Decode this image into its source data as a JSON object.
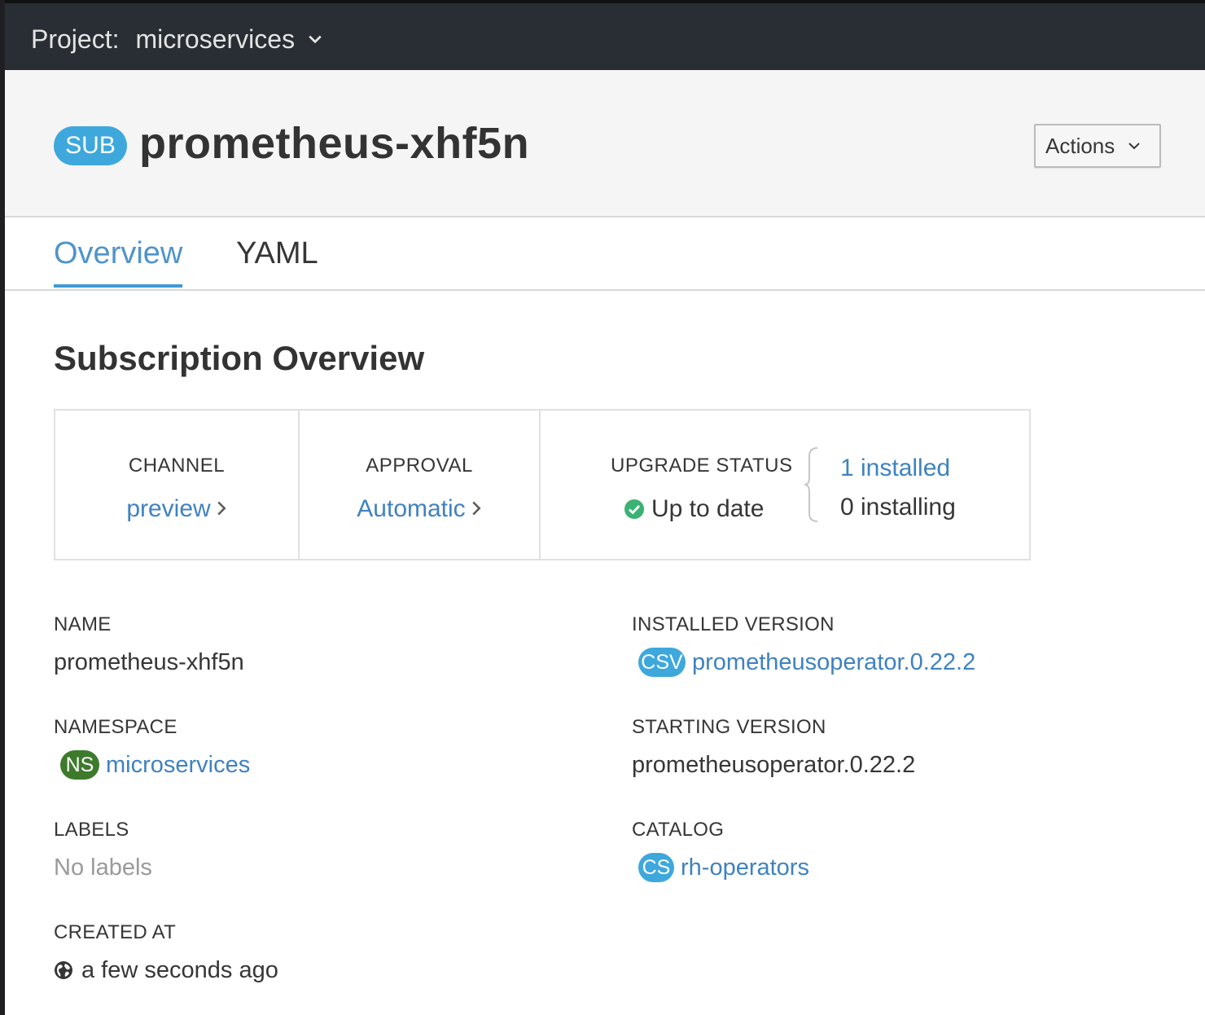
{
  "topbar": {
    "project_label": "Project:",
    "project_name": "microservices"
  },
  "header": {
    "badge": "SUB",
    "title": "prometheus-xhf5n",
    "actions_label": "Actions"
  },
  "tabs": [
    {
      "label": "Overview",
      "active": true
    },
    {
      "label": "YAML",
      "active": false
    }
  ],
  "section": {
    "title": "Subscription Overview"
  },
  "status": {
    "channel_label": "CHANNEL",
    "channel_value": "preview",
    "approval_label": "APPROVAL",
    "approval_value": "Automatic",
    "upgrade_label": "UPGRADE STATUS",
    "upgrade_value": "Up to date",
    "installed": "1 installed",
    "installing": "0 installing"
  },
  "details": {
    "name_label": "NAME",
    "name_value": "prometheus-xhf5n",
    "namespace_label": "NAMESPACE",
    "namespace_badge": "NS",
    "namespace_value": "microservices",
    "labels_label": "LABELS",
    "labels_value": "No labels",
    "created_label": "CREATED AT",
    "created_value": "a few seconds ago",
    "installed_version_label": "INSTALLED VERSION",
    "installed_version_badge": "CSV",
    "installed_version_value": "prometheusoperator.0.22.2",
    "starting_version_label": "STARTING VERSION",
    "starting_version_value": "prometheusoperator.0.22.2",
    "catalog_label": "CATALOG",
    "catalog_badge": "CS",
    "catalog_value": "rh-operators"
  },
  "colors": {
    "topbar_bg": "#292e34",
    "link": "#3f82c0",
    "active_tab": "#4f94c9",
    "badge_blue": "#3ea8dd",
    "badge_green": "#3d7a2c",
    "success": "#3bb273"
  },
  "icons": {
    "project_dropdown": "chevron-down-icon",
    "actions_dropdown": "chevron-down-icon",
    "channel_link": "chevron-right-icon",
    "approval_link": "chevron-right-icon",
    "upgrade_status": "check-circle-icon",
    "created_at": "globe-icon"
  }
}
